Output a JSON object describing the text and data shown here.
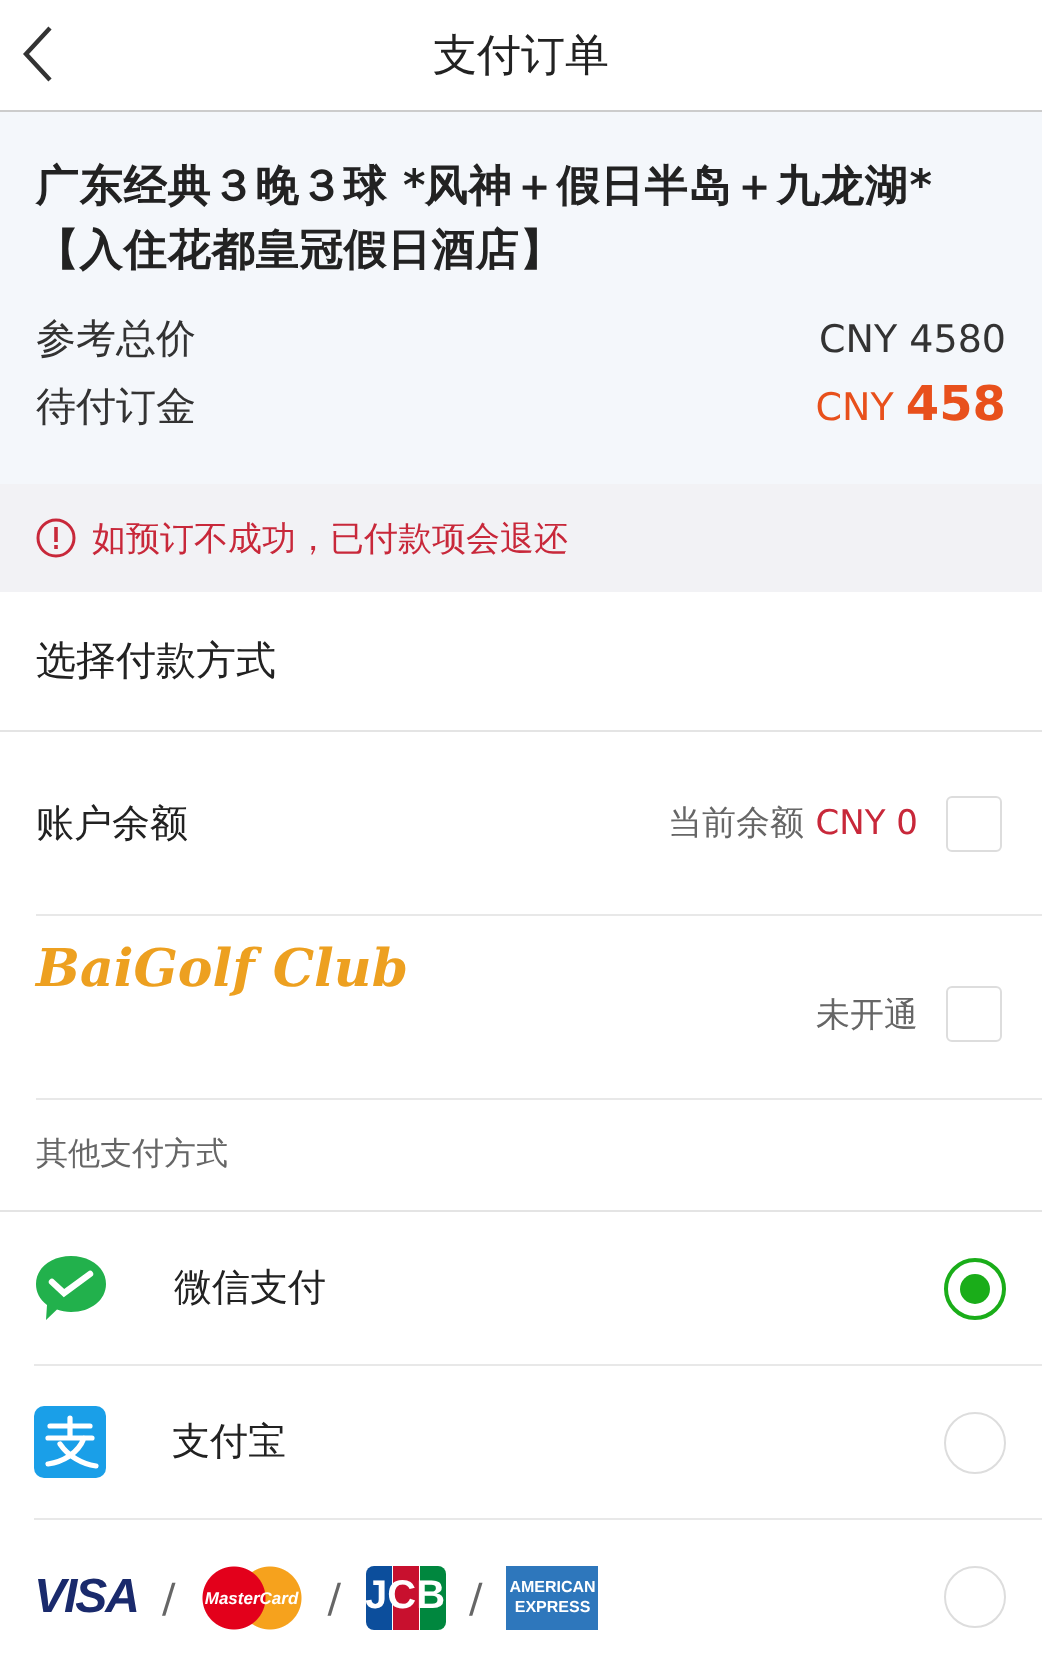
{
  "header": {
    "title": "支付订单"
  },
  "order": {
    "title": "广东经典３晚３球 *风神＋假日半岛＋九龙湖*【入住花都皇冠假日酒店】",
    "prices": [
      {
        "kind": "reference",
        "label": "参考总价",
        "currency": "CNY",
        "amount": "4580"
      },
      {
        "kind": "deposit",
        "label": "待付订金",
        "currency": "CNY",
        "amount": "458"
      }
    ]
  },
  "notice": {
    "text": "如预订不成功，已付款项会退还"
  },
  "section_title": "选择付款方式",
  "accounts": [
    {
      "kind": "balance",
      "label": "账户余额",
      "note": "当前余额",
      "amount": "CNY 0",
      "checked": false
    },
    {
      "kind": "club",
      "logo": "BaiGolf Club",
      "note": "未开通",
      "checked": false
    }
  ],
  "other_title": "其他支付方式",
  "methods": [
    {
      "kind": "wechat",
      "label": "微信支付",
      "selected": true
    },
    {
      "kind": "alipay",
      "label": "支付宝",
      "selected": false
    },
    {
      "kind": "cards",
      "items": [
        {
          "kind": "visa",
          "text": "VISA"
        },
        {
          "kind": "slash",
          "text": "/"
        },
        {
          "kind": "mastercard",
          "text": "MasterCard"
        },
        {
          "kind": "slash",
          "text": "/"
        },
        {
          "kind": "jcb",
          "text": "JCB"
        },
        {
          "kind": "slash",
          "text": "/"
        },
        {
          "kind": "amex",
          "text": "AMERICAN EXPRESS"
        }
      ],
      "selected": false
    }
  ]
}
